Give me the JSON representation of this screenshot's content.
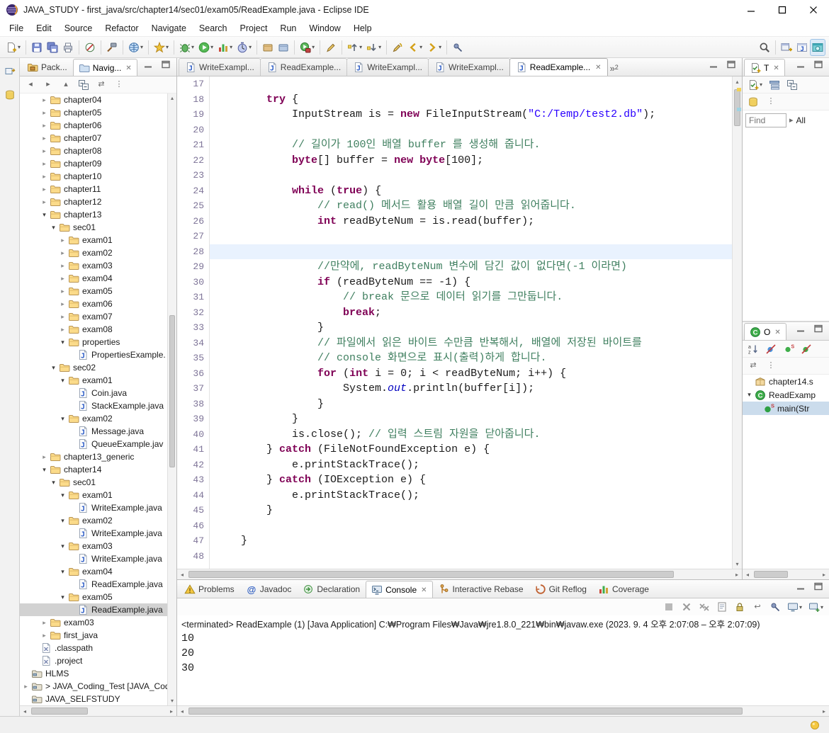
{
  "titlebar": {
    "title": "JAVA_STUDY - first_java/src/chapter14/sec01/exam05/ReadExample.java - Eclipse IDE"
  },
  "menubar": {
    "items": [
      "File",
      "Edit",
      "Source",
      "Refactor",
      "Navigate",
      "Search",
      "Project",
      "Run",
      "Window",
      "Help"
    ]
  },
  "toolbar": {
    "groups": [
      [
        "new-wizard*"
      ],
      [
        "save",
        "save-all",
        "print"
      ],
      [
        "skip-breakpoints"
      ],
      [
        "build-all"
      ],
      [
        "web-browser*"
      ],
      [
        "wizard-star*"
      ],
      [
        "debug*",
        "run*",
        "coverage*",
        "profile*"
      ],
      [
        "open-type",
        "open-task"
      ],
      [
        "external-tools*"
      ],
      [
        "mark-occurrences"
      ],
      [
        "previous-annotation*",
        "next-annotation*"
      ],
      [
        "last-edit-location",
        "back*",
        "forward*"
      ],
      [
        "pin-editor"
      ]
    ],
    "right": [
      "search",
      "open-perspective",
      "java-perspective",
      "web-perspective!"
    ]
  },
  "leftstrip": {
    "icons": [
      "restore-views",
      "git-repositories"
    ]
  },
  "explorer": {
    "tabs": [
      {
        "label": "Pack...",
        "icon": "package-explorer",
        "active": false
      },
      {
        "label": "Navig...",
        "icon": "navigator",
        "active": true,
        "closable": true
      }
    ],
    "toolbar": [
      "back-nav",
      "forward-nav",
      "up-nav",
      "collapse-all",
      "link-editor",
      "view-menu"
    ],
    "tree": [
      {
        "level": 2,
        "expand": "c",
        "icon": "folder",
        "label": "chapter04"
      },
      {
        "level": 2,
        "expand": "c",
        "icon": "folder",
        "label": "chapter05"
      },
      {
        "level": 2,
        "expand": "c",
        "icon": "folder",
        "label": "chapter06"
      },
      {
        "level": 2,
        "expand": "c",
        "icon": "folder",
        "label": "chapter07"
      },
      {
        "level": 2,
        "expand": "c",
        "icon": "folder",
        "label": "chapter08"
      },
      {
        "level": 2,
        "expand": "c",
        "icon": "folder",
        "label": "chapter09"
      },
      {
        "level": 2,
        "expand": "c",
        "icon": "folder",
        "label": "chapter10"
      },
      {
        "level": 2,
        "expand": "c",
        "icon": "folder",
        "label": "chapter11"
      },
      {
        "level": 2,
        "expand": "c",
        "icon": "folder",
        "label": "chapter12"
      },
      {
        "level": 2,
        "expand": "e",
        "icon": "folder",
        "label": "chapter13"
      },
      {
        "level": 3,
        "expand": "e",
        "icon": "folder",
        "label": "sec01"
      },
      {
        "level": 4,
        "expand": "c",
        "icon": "folder",
        "label": "exam01"
      },
      {
        "level": 4,
        "expand": "c",
        "icon": "folder",
        "label": "exam02"
      },
      {
        "level": 4,
        "expand": "c",
        "icon": "folder",
        "label": "exam03"
      },
      {
        "level": 4,
        "expand": "c",
        "icon": "folder",
        "label": "exam04"
      },
      {
        "level": 4,
        "expand": "c",
        "icon": "folder",
        "label": "exam05"
      },
      {
        "level": 4,
        "expand": "c",
        "icon": "folder",
        "label": "exam06"
      },
      {
        "level": 4,
        "expand": "c",
        "icon": "folder",
        "label": "exam07"
      },
      {
        "level": 4,
        "expand": "c",
        "icon": "folder",
        "label": "exam08"
      },
      {
        "level": 4,
        "expand": "e",
        "icon": "folder",
        "label": "properties"
      },
      {
        "level": 5,
        "expand": "n",
        "icon": "jfile",
        "label": "PropertiesExample."
      },
      {
        "level": 3,
        "expand": "e",
        "icon": "folder",
        "label": "sec02"
      },
      {
        "level": 4,
        "expand": "e",
        "icon": "folder",
        "label": "exam01"
      },
      {
        "level": 5,
        "expand": "n",
        "icon": "jfile",
        "label": "Coin.java"
      },
      {
        "level": 5,
        "expand": "n",
        "icon": "jfile",
        "label": "StackExample.java"
      },
      {
        "level": 4,
        "expand": "e",
        "icon": "folder",
        "label": "exam02"
      },
      {
        "level": 5,
        "expand": "n",
        "icon": "jfile",
        "label": "Message.java"
      },
      {
        "level": 5,
        "expand": "n",
        "icon": "jfile",
        "label": "QueueExample.jav"
      },
      {
        "level": 2,
        "expand": "c",
        "icon": "folder",
        "label": "chapter13_generic"
      },
      {
        "level": 2,
        "expand": "e",
        "icon": "folder",
        "label": "chapter14"
      },
      {
        "level": 3,
        "expand": "e",
        "icon": "folder",
        "label": "sec01"
      },
      {
        "level": 4,
        "expand": "e",
        "icon": "folder",
        "label": "exam01"
      },
      {
        "level": 5,
        "expand": "n",
        "icon": "jfile",
        "label": "WriteExample.java"
      },
      {
        "level": 4,
        "expand": "e",
        "icon": "folder",
        "label": "exam02"
      },
      {
        "level": 5,
        "expand": "n",
        "icon": "jfile",
        "label": "WriteExample.java"
      },
      {
        "level": 4,
        "expand": "e",
        "icon": "folder",
        "label": "exam03"
      },
      {
        "level": 5,
        "expand": "n",
        "icon": "jfile",
        "label": "WriteExample.java"
      },
      {
        "level": 4,
        "expand": "e",
        "icon": "folder",
        "label": "exam04"
      },
      {
        "level": 5,
        "expand": "n",
        "icon": "jfile",
        "label": "ReadExample.java"
      },
      {
        "level": 4,
        "expand": "e",
        "icon": "folder",
        "label": "exam05"
      },
      {
        "level": 5,
        "expand": "n",
        "icon": "jfile",
        "label": "ReadExample.java",
        "selected": true
      },
      {
        "level": 2,
        "expand": "c",
        "icon": "folder",
        "label": "exam03"
      },
      {
        "level": 2,
        "expand": "c",
        "icon": "folder",
        "label": "first_java"
      },
      {
        "level": 1,
        "expand": "n",
        "icon": "xfile",
        "label": ".classpath"
      },
      {
        "level": 1,
        "expand": "n",
        "icon": "xfile",
        "label": ".project"
      },
      {
        "level": 0,
        "expand": "n",
        "icon": "project",
        "label": "HLMS"
      },
      {
        "level": 0,
        "expand": "c",
        "icon": "project",
        "label": "> JAVA_Coding_Test [JAVA_Codir"
      },
      {
        "level": 0,
        "expand": "n",
        "icon": "project",
        "label": "JAVA_SELFSTUDY"
      }
    ]
  },
  "editor": {
    "tabs": [
      {
        "label": "WriteExampl..."
      },
      {
        "label": "ReadExample..."
      },
      {
        "label": "WriteExampl..."
      },
      {
        "label": "WriteExampl..."
      },
      {
        "label": "ReadExample...",
        "active": true,
        "closable": true
      }
    ],
    "overflow": {
      "chevron": "»",
      "count": "2"
    },
    "code": {
      "current_line": 28,
      "lines": [
        {
          "n": 17,
          "seg": []
        },
        {
          "n": 18,
          "seg": [
            [
              "        "
            ],
            [
              "try",
              "k"
            ],
            [
              " {"
            ]
          ]
        },
        {
          "n": 19,
          "seg": [
            [
              "            InputStream is = "
            ],
            [
              "new",
              "k"
            ],
            [
              " FileInputStream("
            ],
            [
              "\"C:/Temp/test2.db\"",
              "s"
            ],
            [
              ");"
            ]
          ]
        },
        {
          "n": 20,
          "seg": []
        },
        {
          "n": 21,
          "seg": [
            [
              "            "
            ],
            [
              "// 길이가 100인 배열 buffer 를 생성해 줍니다.",
              "c"
            ]
          ]
        },
        {
          "n": 22,
          "seg": [
            [
              "            "
            ],
            [
              "byte",
              "k"
            ],
            [
              "[] buffer = "
            ],
            [
              "new",
              "k"
            ],
            [
              " "
            ],
            [
              "byte",
              "k"
            ],
            [
              "[100];"
            ]
          ]
        },
        {
          "n": 23,
          "seg": []
        },
        {
          "n": 24,
          "seg": [
            [
              "            "
            ],
            [
              "while",
              "k"
            ],
            [
              " ("
            ],
            [
              "true",
              "k"
            ],
            [
              ") {"
            ]
          ]
        },
        {
          "n": 25,
          "seg": [
            [
              "                "
            ],
            [
              "// read() 메서드 활용 배열 길이 만큼 읽어줍니다.",
              "c"
            ]
          ]
        },
        {
          "n": 26,
          "seg": [
            [
              "                "
            ],
            [
              "int",
              "k"
            ],
            [
              " readByteNum = is.read(buffer);"
            ]
          ]
        },
        {
          "n": 27,
          "seg": []
        },
        {
          "n": 28,
          "seg": [],
          "hl": true
        },
        {
          "n": 29,
          "seg": [
            [
              "                "
            ],
            [
              "//만약에, readByteNum 변수에 담긴 값이 없다면(-1 이라면)",
              "c"
            ]
          ]
        },
        {
          "n": 30,
          "seg": [
            [
              "                "
            ],
            [
              "if",
              "k"
            ],
            [
              " (readByteNum == -1) {"
            ]
          ]
        },
        {
          "n": 31,
          "seg": [
            [
              "                    "
            ],
            [
              "// break 문으로 데이터 읽기를 그만둡니다.",
              "c"
            ]
          ]
        },
        {
          "n": 32,
          "seg": [
            [
              "                    "
            ],
            [
              "break",
              "k"
            ],
            [
              ";"
            ]
          ]
        },
        {
          "n": 33,
          "seg": [
            [
              "                }"
            ]
          ]
        },
        {
          "n": 34,
          "seg": [
            [
              "                "
            ],
            [
              "// 파일에서 읽은 바이트 수만큼 반복해서, 배열에 저장된 바이트를",
              "c"
            ]
          ]
        },
        {
          "n": 35,
          "seg": [
            [
              "                "
            ],
            [
              "// console 화면으로 표시(출력)하게 합니다.",
              "c"
            ]
          ]
        },
        {
          "n": 36,
          "seg": [
            [
              "                "
            ],
            [
              "for",
              "k"
            ],
            [
              " ("
            ],
            [
              "int",
              "k"
            ],
            [
              " i = 0; i < readByteNum; i++) {"
            ]
          ]
        },
        {
          "n": 37,
          "seg": [
            [
              "                    System."
            ],
            [
              "out",
              "f"
            ],
            [
              ".println(buffer[i]);"
            ]
          ]
        },
        {
          "n": 38,
          "seg": [
            [
              "                }"
            ]
          ]
        },
        {
          "n": 39,
          "seg": [
            [
              "            }"
            ]
          ]
        },
        {
          "n": 40,
          "seg": [
            [
              "            is.close(); "
            ],
            [
              "// 입력 스트림 자원을 닫아줍니다.",
              "c"
            ]
          ]
        },
        {
          "n": 41,
          "seg": [
            [
              "        } "
            ],
            [
              "catch",
              "k"
            ],
            [
              " (FileNotFoundException e) {"
            ]
          ]
        },
        {
          "n": 42,
          "seg": [
            [
              "            e.printStackTrace();"
            ]
          ]
        },
        {
          "n": 43,
          "seg": [
            [
              "        } "
            ],
            [
              "catch",
              "k"
            ],
            [
              " (IOException e) {"
            ]
          ]
        },
        {
          "n": 44,
          "seg": [
            [
              "            e.printStackTrace();"
            ]
          ]
        },
        {
          "n": 45,
          "seg": [
            [
              "        }"
            ]
          ]
        },
        {
          "n": 46,
          "seg": []
        },
        {
          "n": 47,
          "seg": [
            [
              "    }"
            ]
          ]
        },
        {
          "n": 48,
          "seg": []
        }
      ]
    }
  },
  "tasklist": {
    "tab_label": "T",
    "toolbar_row1": [
      "new-task*",
      "categorized",
      "collapse-all"
    ],
    "toolbar_row2": [
      "task-repositories",
      "view-menu"
    ],
    "find_placeholder": "Find",
    "find_caret": "▸",
    "find_all": "All"
  },
  "outline": {
    "tab_label": "O",
    "toolbar_row1": [
      "sort",
      "hide-fields",
      "hide-static",
      "hide-non-public"
    ],
    "toolbar_row2": [
      "link-editor",
      "view-menu"
    ],
    "items": [
      {
        "icon": "package-decl",
        "label": "chapter14.s",
        "expand": "n",
        "level": 0
      },
      {
        "icon": "class",
        "label": "ReadExamp",
        "expand": "e",
        "level": 0
      },
      {
        "icon": "method-static",
        "label": "main(Str",
        "expand": "n",
        "level": 1,
        "selected": true
      }
    ]
  },
  "console": {
    "tabs": [
      {
        "label": "Problems",
        "icon": "problems"
      },
      {
        "label": "Javadoc",
        "icon": "javadoc"
      },
      {
        "label": "Declaration",
        "icon": "declaration"
      },
      {
        "label": "Console",
        "icon": "console-view",
        "active": true,
        "closable": true
      },
      {
        "label": "Interactive Rebase",
        "icon": "rebase"
      },
      {
        "label": "Git Reflog",
        "icon": "reflog"
      },
      {
        "label": "Coverage",
        "icon": "coverage"
      }
    ],
    "toolbar": [
      "terminate",
      "remove-launch",
      "remove-all",
      "clear-console",
      "scroll-lock",
      "word-wrap",
      "pin-console",
      "display-console*",
      "open-console*"
    ],
    "status": "<terminated> ReadExample (1) [Java Application] C:₩Program Files₩Java₩jre1.8.0_221₩bin₩javaw.exe  (2023. 9. 4 오후 2:07:08 – 오후 2:07:09)",
    "output": [
      "10",
      "20",
      "30"
    ]
  },
  "statusbar": {
    "icons": [
      "notifications"
    ]
  }
}
